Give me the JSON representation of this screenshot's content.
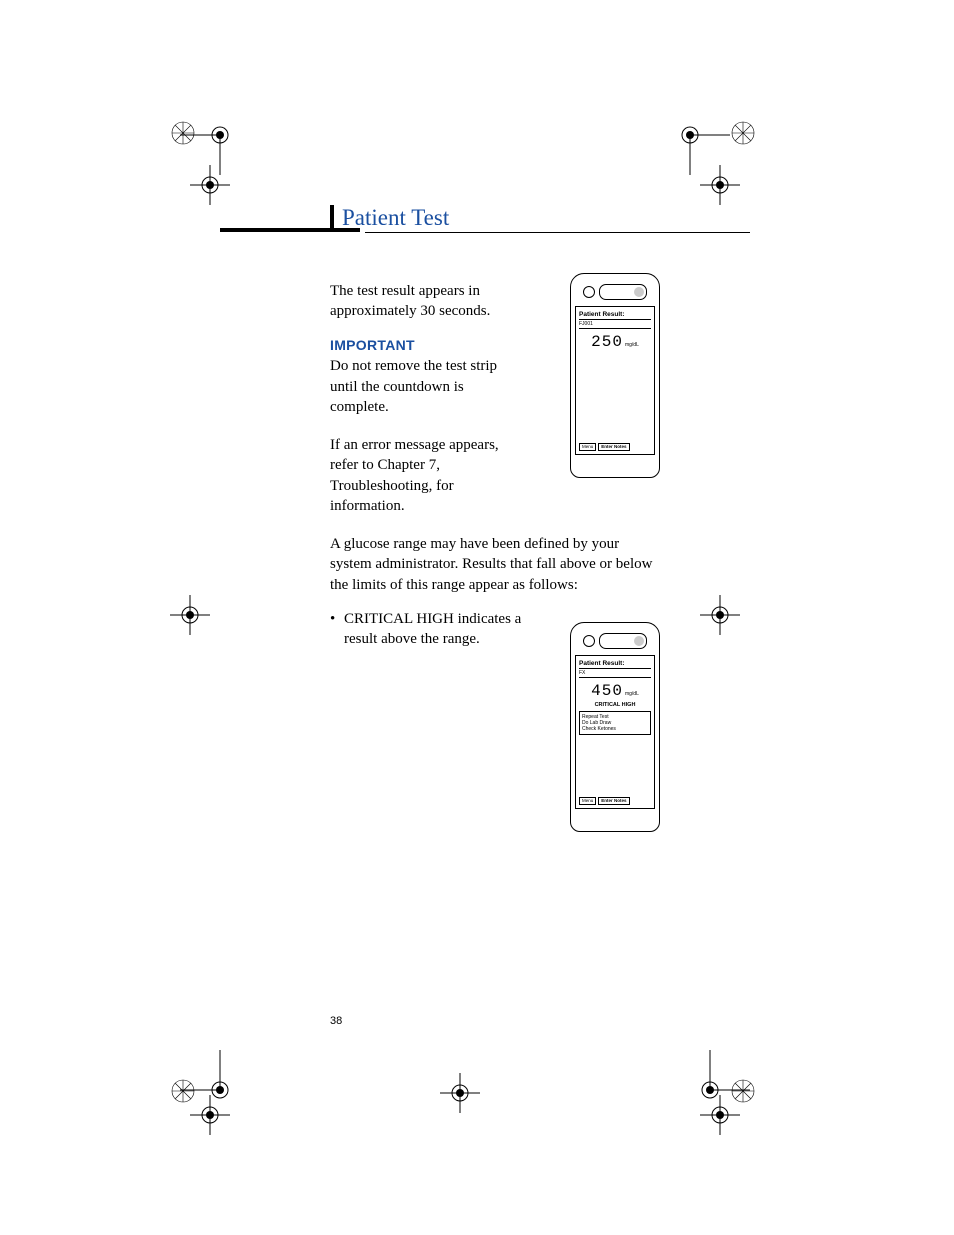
{
  "header": {
    "title": "Patient Test"
  },
  "body": {
    "p1": "The test result appears in approximately 30 seconds.",
    "important_label": "IMPORTANT",
    "p2": "Do not remove the test strip until the countdown is complete.",
    "p3": "If an error message appears, refer to Chapter 7, Troubleshooting, for information.",
    "p4": "A glucose range may have been defined by your system administrator. Results that fall above or below the limits of this range appear as follows:",
    "bullet1_title": "CRITICAL HIGH",
    "bullet1_rest": "indicates a result above the range."
  },
  "device1": {
    "title": "Patient Result:",
    "sub": "FJ001",
    "value": "250",
    "unit": "mg/dL",
    "menu": "Menu",
    "enter": "Enter Notes"
  },
  "device2": {
    "title": "Patient Result:",
    "sub": "FX",
    "value": "450",
    "unit": "mg/dL",
    "crit": "CRITICAL HIGH",
    "instr1": "Repeat Test",
    "instr2": "Do Lab Draw",
    "instr3": "Check Ketones",
    "menu": "Menu",
    "enter": "Enter Notes"
  },
  "page_number": "38"
}
